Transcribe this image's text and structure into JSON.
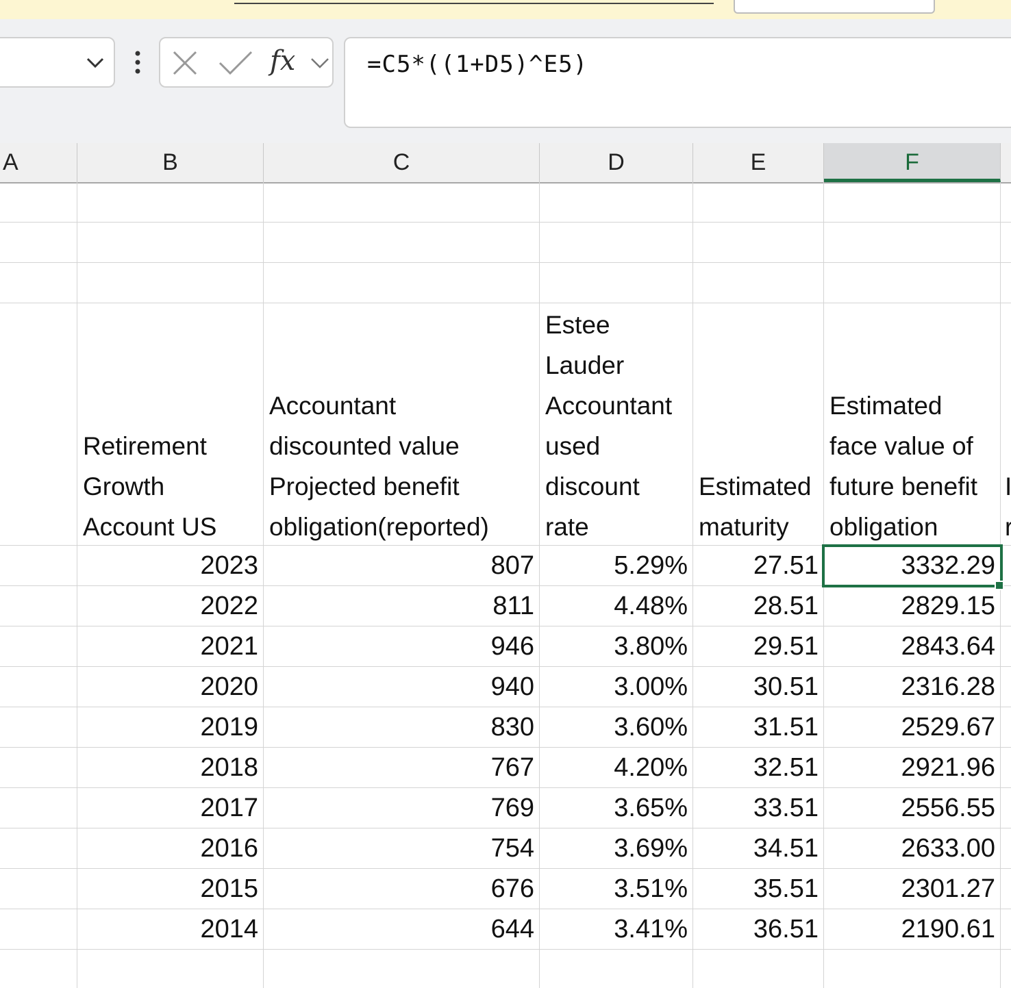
{
  "formula_bar": {
    "formula": "=C5*((1+D5)^E5)",
    "fx_label": "fx"
  },
  "columns": [
    "A",
    "B",
    "C",
    "D",
    "E",
    "F"
  ],
  "active_column": "F",
  "headers": {
    "B": "Retirement\nGrowth\nAccount US",
    "C": "Accountant\ndiscounted value\nProjected benefit\nobligation(reported)",
    "D": "Estee\nLauder\nAccountant\nused\ndiscount\nrate",
    "E": "Estimated\nmaturity",
    "F": "Estimated\nface value of\nfuture benefit\nobligation",
    "G_partial": "I\nr"
  },
  "rows": [
    {
      "year": "2023",
      "pbo": "807",
      "rate": "5.29%",
      "maturity": "27.51",
      "face": "3332.29"
    },
    {
      "year": "2022",
      "pbo": "811",
      "rate": "4.48%",
      "maturity": "28.51",
      "face": "2829.15"
    },
    {
      "year": "2021",
      "pbo": "946",
      "rate": "3.80%",
      "maturity": "29.51",
      "face": "2843.64"
    },
    {
      "year": "2020",
      "pbo": "940",
      "rate": "3.00%",
      "maturity": "30.51",
      "face": "2316.28"
    },
    {
      "year": "2019",
      "pbo": "830",
      "rate": "3.60%",
      "maturity": "31.51",
      "face": "2529.67"
    },
    {
      "year": "2018",
      "pbo": "767",
      "rate": "4.20%",
      "maturity": "32.51",
      "face": "2921.96"
    },
    {
      "year": "2017",
      "pbo": "769",
      "rate": "3.65%",
      "maturity": "33.51",
      "face": "2556.55"
    },
    {
      "year": "2016",
      "pbo": "754",
      "rate": "3.69%",
      "maturity": "34.51",
      "face": "2633.00"
    },
    {
      "year": "2015",
      "pbo": "676",
      "rate": "3.51%",
      "maturity": "35.51",
      "face": "2301.27"
    },
    {
      "year": "2014",
      "pbo": "644",
      "rate": "3.41%",
      "maturity": "36.51",
      "face": "2190.61"
    }
  ],
  "colors": {
    "selection": "#1e7145",
    "notification_bg": "#fdf6d2",
    "gridline": "#d4d4d4"
  },
  "icons": [
    "chevron-down-icon",
    "more-vertical-icon",
    "cancel-x-icon",
    "confirm-check-icon",
    "function-fx-icon"
  ]
}
